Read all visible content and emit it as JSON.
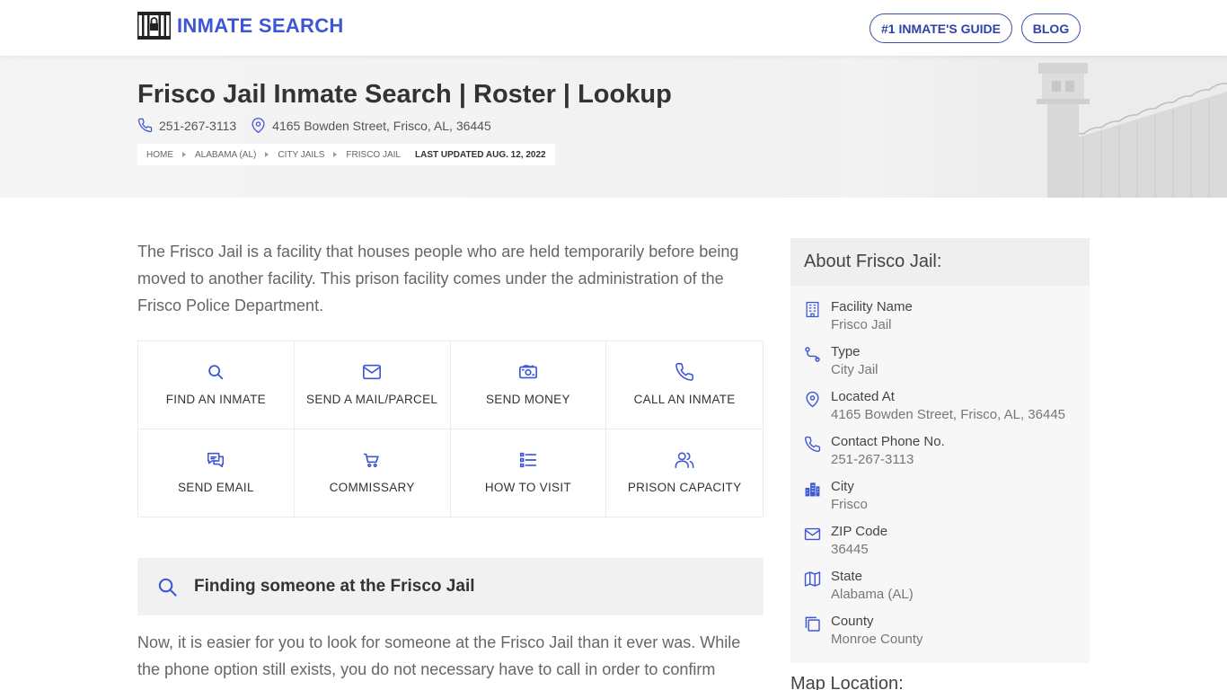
{
  "header": {
    "logo_text": "INMATE SEARCH",
    "logo_icon": "jail-lock-icon",
    "nav": [
      {
        "label": "#1 INMATE'S GUIDE"
      },
      {
        "label": "BLOG"
      }
    ]
  },
  "hero": {
    "title": "Frisco Jail Inmate Search | Roster | Lookup",
    "phone": "251-267-3113",
    "address": "4165 Bowden Street, Frisco, AL, 36445",
    "breadcrumbs": [
      "HOME",
      "ALABAMA (AL)",
      "CITY JAILS",
      "FRISCO JAIL"
    ],
    "last_updated": "LAST UPDATED AUG. 12, 2022"
  },
  "intro": "The Frisco Jail is a facility that houses people who are held temporarily before being moved to another facility. This prison facility comes under the administration of the Frisco Police Department.",
  "actions": [
    {
      "label": "FIND AN INMATE",
      "icon": "search-icon"
    },
    {
      "label": "SEND A MAIL/PARCEL",
      "icon": "mail-icon"
    },
    {
      "label": "SEND MONEY",
      "icon": "money-icon"
    },
    {
      "label": "CALL AN INMATE",
      "icon": "phone-icon"
    },
    {
      "label": "SEND EMAIL",
      "icon": "chat-icon"
    },
    {
      "label": "COMMISSARY",
      "icon": "cart-icon"
    },
    {
      "label": "HOW TO VISIT",
      "icon": "list-icon"
    },
    {
      "label": "PRISON CAPACITY",
      "icon": "users-icon"
    }
  ],
  "finding": {
    "heading": "Finding someone at the Frisco Jail",
    "paragraph": "Now, it is easier for you to look for someone at the Frisco Jail than it ever was. While the phone option still exists, you do not necessary have to call in order to confirm"
  },
  "about": {
    "heading": "About Frisco Jail:",
    "items": [
      {
        "label": "Facility Name",
        "value": "Frisco Jail",
        "icon": "building-icon"
      },
      {
        "label": "Type",
        "value": "City Jail",
        "icon": "route-icon"
      },
      {
        "label": "Located At",
        "value": "4165 Bowden Street, Frisco, AL, 36445",
        "icon": "map-pin-icon"
      },
      {
        "label": "Contact Phone No.",
        "value": "251-267-3113",
        "icon": "phone-icon"
      },
      {
        "label": "City",
        "value": "Frisco",
        "icon": "city-icon"
      },
      {
        "label": "ZIP Code",
        "value": "36445",
        "icon": "envelope-icon"
      },
      {
        "label": "State",
        "value": "Alabama (AL)",
        "icon": "map-icon"
      },
      {
        "label": "County",
        "value": "Monroe County",
        "icon": "copy-icon"
      }
    ]
  },
  "map_heading": "Map Location:",
  "colors": {
    "accent": "#3d56d6",
    "text": "#333333",
    "muted": "#666666",
    "panel": "#f7f7f7"
  }
}
